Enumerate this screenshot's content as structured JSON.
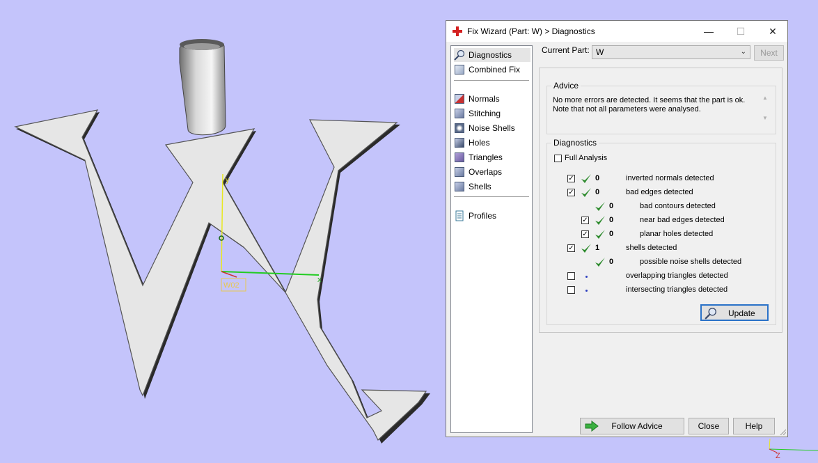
{
  "window": {
    "title": "Fix Wizard (Part: W) > Diagnostics",
    "controls": {
      "minimize": "—",
      "maximize": "☐",
      "close": "✕"
    }
  },
  "nav": {
    "items": [
      {
        "label": "Diagnostics",
        "icon": "magnifier-icon",
        "selected": true
      },
      {
        "label": "Combined Fix",
        "icon": "cube-icon"
      },
      {
        "label": "Normals",
        "icon": "cube-icon"
      },
      {
        "label": "Stitching",
        "icon": "cube-icon"
      },
      {
        "label": "Noise Shells",
        "icon": "cube-icon"
      },
      {
        "label": "Holes",
        "icon": "cube-icon"
      },
      {
        "label": "Triangles",
        "icon": "cube-icon"
      },
      {
        "label": "Overlaps",
        "icon": "cube-icon"
      },
      {
        "label": "Shells",
        "icon": "cube-icon"
      },
      {
        "label": "Profiles",
        "icon": "document-icon"
      }
    ]
  },
  "current_part": {
    "label": "Current Part:",
    "value": "W"
  },
  "next_button": "Next",
  "advice": {
    "title": "Advice",
    "text": "No more errors are detected. It seems that the part is ok. Note that not all parameters were analysed."
  },
  "diagnostics": {
    "title": "Diagnostics",
    "full_analysis": {
      "label": "Full Analysis",
      "checked": false
    },
    "rows": [
      {
        "checked": true,
        "ok": true,
        "count": "0",
        "label": "inverted normals detected",
        "indent": 0
      },
      {
        "checked": true,
        "ok": true,
        "count": "0",
        "label": "bad edges detected",
        "indent": 0
      },
      {
        "checked": null,
        "ok": true,
        "count": "0",
        "label": "bad contours detected",
        "indent": 1
      },
      {
        "checked": true,
        "ok": true,
        "count": "0",
        "label": "near bad edges detected",
        "indent": 1
      },
      {
        "checked": true,
        "ok": true,
        "count": "0",
        "label": "planar holes detected",
        "indent": 1
      },
      {
        "checked": true,
        "ok": true,
        "count": "1",
        "label": "shells detected",
        "indent": 0
      },
      {
        "checked": null,
        "ok": true,
        "count": "0",
        "label": "possible noise shells detected",
        "indent": 1
      },
      {
        "checked": false,
        "ok": false,
        "count": "",
        "label": "overlapping triangles detected",
        "indent": 0
      },
      {
        "checked": false,
        "ok": false,
        "count": "",
        "label": "intersecting triangles detected",
        "indent": 0
      }
    ],
    "update_button": "Update"
  },
  "buttons": {
    "follow_advice": "Follow Advice",
    "close": "Close",
    "help": "Help"
  },
  "viewport": {
    "part_label": "W02",
    "axis_x": "x",
    "axis_y": "y",
    "axis_z": "Z"
  },
  "colors": {
    "background": "#c4c4fb",
    "check_green": "#2e8b2e",
    "axis_x": "#22cc22",
    "axis_y": "#e8e820",
    "focus_blue": "#2a72c8"
  }
}
